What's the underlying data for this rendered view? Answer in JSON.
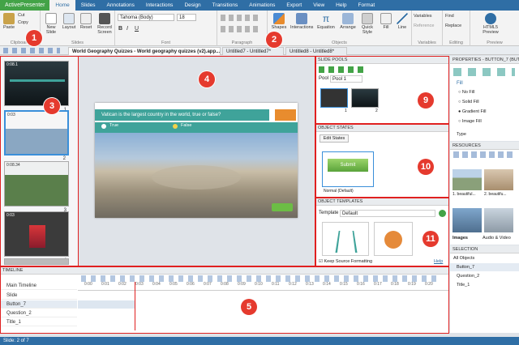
{
  "app_button": "ActivePresenter",
  "menu_tabs": [
    "Home",
    "Slides",
    "Annotations",
    "Interactions",
    "Design",
    "Transitions",
    "Animations",
    "Export",
    "View",
    "Help",
    "Format"
  ],
  "ribbon": {
    "clipboard": {
      "label": "Clipboard",
      "paste": "Paste",
      "cut": "Cut",
      "copy": "Copy"
    },
    "slides": {
      "label": "Slides",
      "new_slide": "New Slide",
      "layout": "Layout",
      "reset": "Reset",
      "record_screen": "Record Screen"
    },
    "font": {
      "label": "Font",
      "font_name": "Tahoma (Body)",
      "font_size": "18"
    },
    "paragraph": {
      "label": "Paragraph"
    },
    "objects": {
      "label": "Objects",
      "shapes": "Shapes",
      "interactions": "Interactions",
      "equation": "Equation",
      "arrange": "Arrange",
      "quick_style": "Quick Style",
      "fill": "Fill",
      "line": "Line"
    },
    "variables": {
      "label": "Variables",
      "variables": "Variables",
      "reference": "Reference"
    },
    "editing": {
      "label": "Editing",
      "find": "Find",
      "replace": "Replace"
    },
    "preview": {
      "label": "Preview",
      "html5_preview": "HTML5 Preview"
    }
  },
  "doc_tabs": [
    "World Geography Quizzes - World geography quizzes (v2).app...",
    "Untitled7 - Untitled7*",
    "Untitled8 - Untitled8*"
  ],
  "slides_panel": {
    "thumbs": [
      {
        "time": "0:08.1",
        "num": "1"
      },
      {
        "time": "0:03",
        "num": "2"
      },
      {
        "time": "0:08.34",
        "num": "3"
      },
      {
        "time": "0:03",
        "num": "4"
      },
      {
        "time": "",
        "num": ""
      }
    ]
  },
  "canvas": {
    "question": "Vatican is the largest country in the world, true or false?",
    "option_true": "True",
    "option_false": "False",
    "submit": "Submit"
  },
  "slide_pools": {
    "header": "SLIDE POOLS",
    "pool_label": "Pool",
    "pool_value": "Pool 1",
    "thumb_nums": [
      "1",
      "2"
    ]
  },
  "object_states": {
    "header": "OBJECT STATES",
    "edit_states": "Edit States",
    "state_button": "Submit",
    "state_caption": "Normal (Default)"
  },
  "object_templates": {
    "header": "OBJECT TEMPLATES",
    "template_label": "Template",
    "template_value": "Default",
    "keep_source": "Keep Source Formatting",
    "help": "Help"
  },
  "properties": {
    "header": "PROPERTIES - BUTTON_7 (BUTTON)",
    "fill_section": "Fill",
    "fill_options": [
      "No Fill",
      "Solid Fill",
      "Gradient Fill",
      "Image Fill"
    ],
    "selected_fill": "Gradient Fill",
    "type_label": "Type"
  },
  "resources": {
    "header": "RESOURCES",
    "items": [
      "1. beautiful...",
      "2. beautifu..."
    ],
    "tabs": [
      "Images",
      "Audio & Video"
    ]
  },
  "selection": {
    "header": "SELECTION",
    "items": [
      "All Objects",
      "Button_7",
      "Question_2",
      "Title_1"
    ]
  },
  "timeline": {
    "header": "TIMELINE",
    "main_timeline": "Main Timeline",
    "rows": [
      "Slide",
      "Button_7",
      "Question_2",
      "Title_1"
    ],
    "ticks": [
      "0:00",
      "0:01",
      "0:02",
      "0:03",
      "0:04",
      "0:05",
      "0:06",
      "0:07",
      "0:08",
      "0:09",
      "0:10",
      "0:11",
      "0:12",
      "0:13",
      "0:14",
      "0:15",
      "0:16",
      "0:17",
      "0:18",
      "0:19",
      "0:20"
    ]
  },
  "status": "Slide: 2 of 7",
  "markers": [
    "1",
    "2",
    "3",
    "4",
    "5",
    "9",
    "10",
    "11"
  ],
  "colors": {
    "accent": "#2f6ea5",
    "marker": "#e53a2e",
    "submit_green": "#6cbd45",
    "quiz_bar": "#3fa39a"
  }
}
